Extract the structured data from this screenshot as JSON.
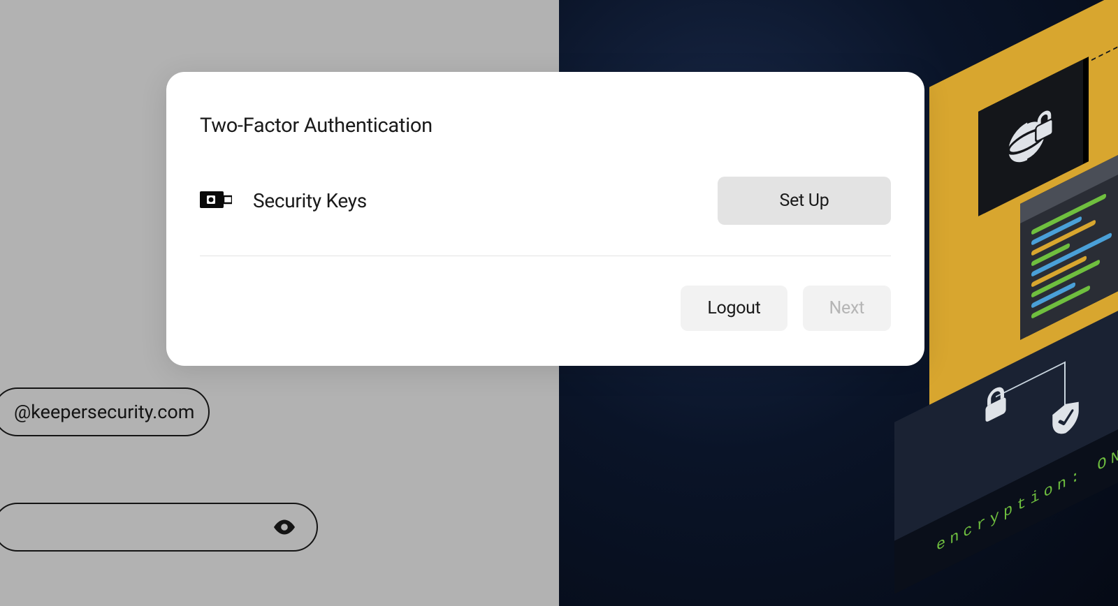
{
  "modal": {
    "title": "Two-Factor Authentication",
    "option_label": "Security Keys",
    "setup_label": "Set Up",
    "logout_label": "Logout",
    "next_label": "Next"
  },
  "background": {
    "email_text": "@keepersecurity.com",
    "encryption_label": "encryption: ON"
  },
  "colors": {
    "modal_bg": "#ffffff",
    "page_bg_left": "#b2b2b2",
    "page_bg_right": "#0a1428",
    "accent_yellow": "#d8a62f",
    "button_gray": "#e3e3e3",
    "text": "#1a1a1a",
    "disabled_text": "#b5b5b5",
    "terminal_green": "#6fbf3f"
  }
}
